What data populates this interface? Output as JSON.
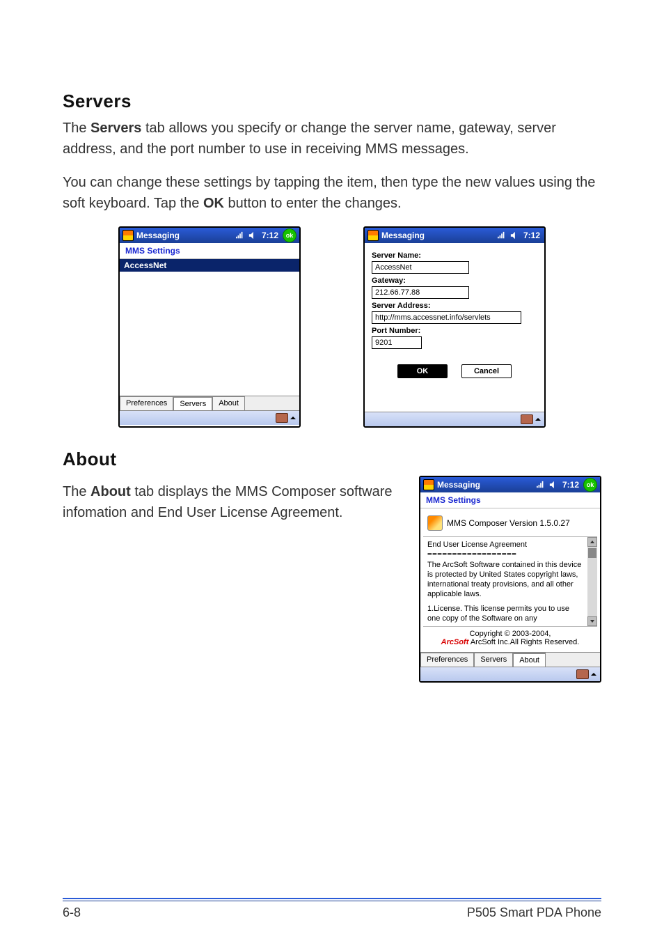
{
  "document": {
    "servers_heading": "Servers",
    "servers_para1_1": "The ",
    "servers_para1_bold": "Servers",
    "servers_para1_2": " tab allows you specify or change the server name, gateway, server address, and the port number to use in receiving MMS messages.",
    "servers_para2_1": "You can change these settings by tapping the item, then type the new values using the soft keyboard. Tap the ",
    "servers_para2_bold": "OK",
    "servers_para2_2": " button to enter the changes.",
    "about_heading": "About",
    "about_para_1": "The ",
    "about_para_bold": "About",
    "about_para_2": " tab displays the MMS Composer software infomation and End User License Agreement."
  },
  "footer": {
    "page": "6-8",
    "product": "P505 Smart PDA Phone"
  },
  "pda_common": {
    "app_title": "Messaging",
    "clock": "7:12",
    "ok_badge": "ok",
    "subheader": "MMS Settings",
    "tabs": {
      "preferences": "Preferences",
      "servers": "Servers",
      "about": "About"
    }
  },
  "pda_servers_list": {
    "selected_server": "AccessNet"
  },
  "pda_server_edit": {
    "labels": {
      "server_name": "Server Name:",
      "gateway": "Gateway:",
      "server_address": "Server Address:",
      "port_number": "Port Number:"
    },
    "values": {
      "server_name": "AccessNet",
      "gateway": "212.66.77.88",
      "server_address": "http://mms.accessnet.info/servlets",
      "port_number": "9201"
    },
    "buttons": {
      "ok": "OK",
      "cancel": "Cancel"
    }
  },
  "pda_about": {
    "version_line": "MMS Composer Version  1.5.0.27",
    "eula_title": "End User License Agreement",
    "eula_dashline": "==================",
    "eula_para1": "The ArcSoft Software contained in this device is protected by United States copyright laws, international treaty provisions, and all other applicable laws.",
    "eula_para2": "1.License.  This license permits you to use one copy of the Software on any",
    "copyright_line1": "Copyright © 2003-2004,",
    "arcsoft_word": "ArcSoft",
    "copyright_line2_rest": " ArcSoft Inc.All Rights Reserved."
  }
}
